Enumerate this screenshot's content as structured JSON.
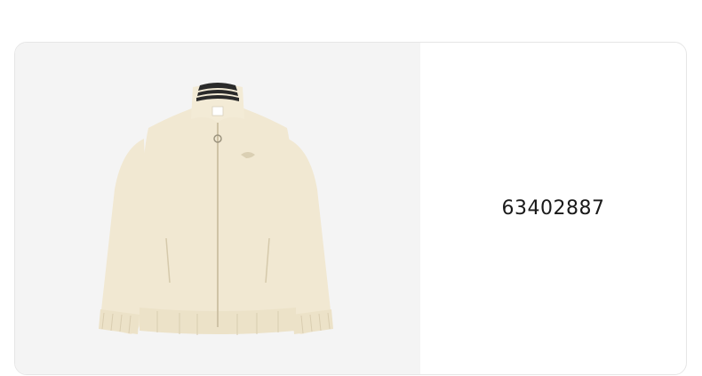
{
  "product": {
    "code": "63402887",
    "image_subject": "jacket-image",
    "colors": {
      "fabric": "#f1e8d2",
      "fabric_shadow": "#e3d8bd",
      "collar_stripe": "#2a2a2a",
      "panel_background": "#f4f4f4"
    }
  }
}
